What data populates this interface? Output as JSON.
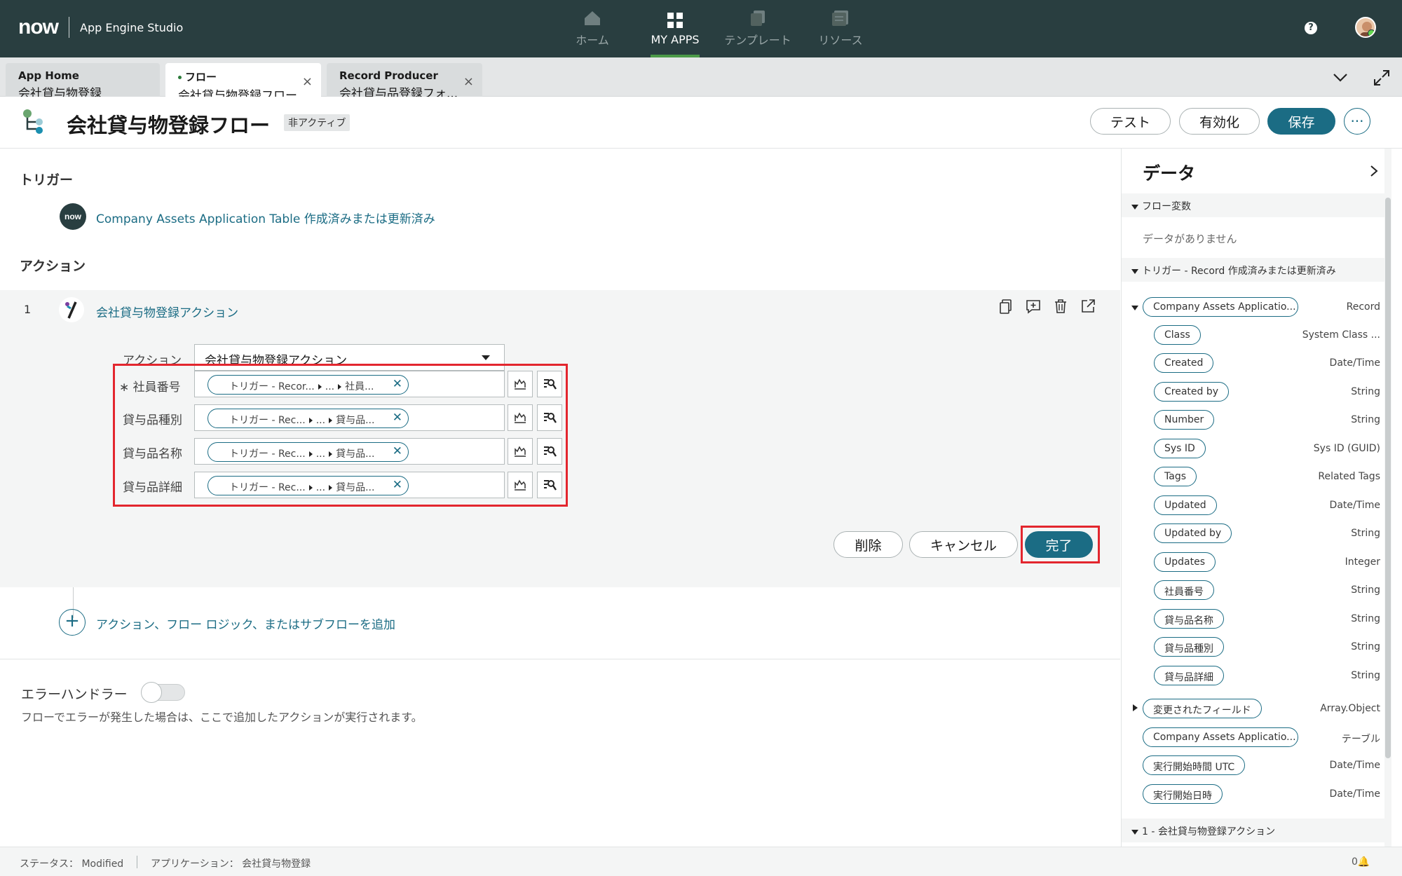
{
  "topbar": {
    "logo": "now",
    "app_name": "App Engine Studio",
    "nav": [
      {
        "label": "ホーム",
        "icon": "home-icon"
      },
      {
        "label": "MY APPS",
        "icon": "grid-icon",
        "active": true
      },
      {
        "label": "テンプレート",
        "icon": "template-icon"
      },
      {
        "label": "リソース",
        "icon": "resources-icon"
      }
    ],
    "help": "?"
  },
  "tabs": [
    {
      "line1": "App Home",
      "line2": "会社貸与物登録"
    },
    {
      "line1": "フロー",
      "line2": "会社貸与物登録フロー",
      "active": true
    },
    {
      "line1": "Record Producer",
      "line2": "会社貸与品登録フォ..."
    }
  ],
  "header": {
    "title": "会社貸与物登録フロー",
    "status": "非アクティブ",
    "buttons": {
      "test": "テスト",
      "activate": "有効化",
      "save": "保存",
      "more": "···"
    }
  },
  "trigger": {
    "heading": "トリガー",
    "badge": "now",
    "link": "Company Assets Application Table 作成済みまたは更新済み"
  },
  "actions": {
    "heading": "アクション",
    "step_number": "1",
    "title": "会社貸与物登録アクション",
    "action_label": "アクション",
    "action_value": "会社貸与物登録アクション",
    "fields": [
      {
        "label": "社員番号",
        "required": true,
        "parts": [
          "トリガー - Recor...",
          "...",
          "社員..."
        ]
      },
      {
        "label": "貸与品種別",
        "parts": [
          "トリガー - Rec...",
          "...",
          "貸与品..."
        ]
      },
      {
        "label": "貸与品名称",
        "parts": [
          "トリガー - Rec...",
          "...",
          "貸与品..."
        ]
      },
      {
        "label": "貸与品詳細",
        "parts": [
          "トリガー - Rec...",
          "...",
          "貸与品..."
        ]
      }
    ],
    "buttons": {
      "delete": "削除",
      "cancel": "キャンセル",
      "done": "完了"
    },
    "required_mark": "∗"
  },
  "add_link": "アクション、フロー ロジック、またはサブフローを追加",
  "error_handler": {
    "label": "エラーハンドラー",
    "description": "フローでエラーが発生した場合は、ここで追加したアクションが実行されます。",
    "enabled": false
  },
  "data_panel": {
    "title": "データ",
    "sections": {
      "flow_vars": "フロー変数",
      "no_data": "データがありません",
      "trigger": "トリガー - Record 作成済みまたは更新済み",
      "action1": "1 - 会社貸与物登録アクション"
    },
    "record": {
      "name": "Company Assets Applicatio...",
      "type": "Record"
    },
    "fields": [
      {
        "name": "Class",
        "type": "System Class ..."
      },
      {
        "name": "Created",
        "type": "Date/Time"
      },
      {
        "name": "Created by",
        "type": "String"
      },
      {
        "name": "Number",
        "type": "String"
      },
      {
        "name": "Sys ID",
        "type": "Sys ID (GUID)"
      },
      {
        "name": "Tags",
        "type": "Related Tags"
      },
      {
        "name": "Updated",
        "type": "Date/Time"
      },
      {
        "name": "Updated by",
        "type": "String"
      },
      {
        "name": "Updates",
        "type": "Integer"
      },
      {
        "name": "社員番号",
        "type": "String"
      },
      {
        "name": "貸与品名称",
        "type": "String"
      },
      {
        "name": "貸与品種別",
        "type": "String"
      },
      {
        "name": "貸与品詳細",
        "type": "String"
      }
    ],
    "extra": [
      {
        "name": "変更されたフィールド",
        "type": "Array.Object"
      },
      {
        "name": "Company Assets Applicatio...",
        "type": "テーブル"
      },
      {
        "name": "実行開始時間 UTC",
        "type": "Date/Time"
      },
      {
        "name": "実行開始日時",
        "type": "Date/Time"
      }
    ]
  },
  "statusbar": {
    "status": "ステータス： Modified",
    "application": "アプリケーション： 会社貸与物登録",
    "notifications": "0🔔"
  },
  "colors": {
    "brand_dark": "#293e40",
    "primary": "#1b6c84",
    "highlight": "#e3262e"
  }
}
